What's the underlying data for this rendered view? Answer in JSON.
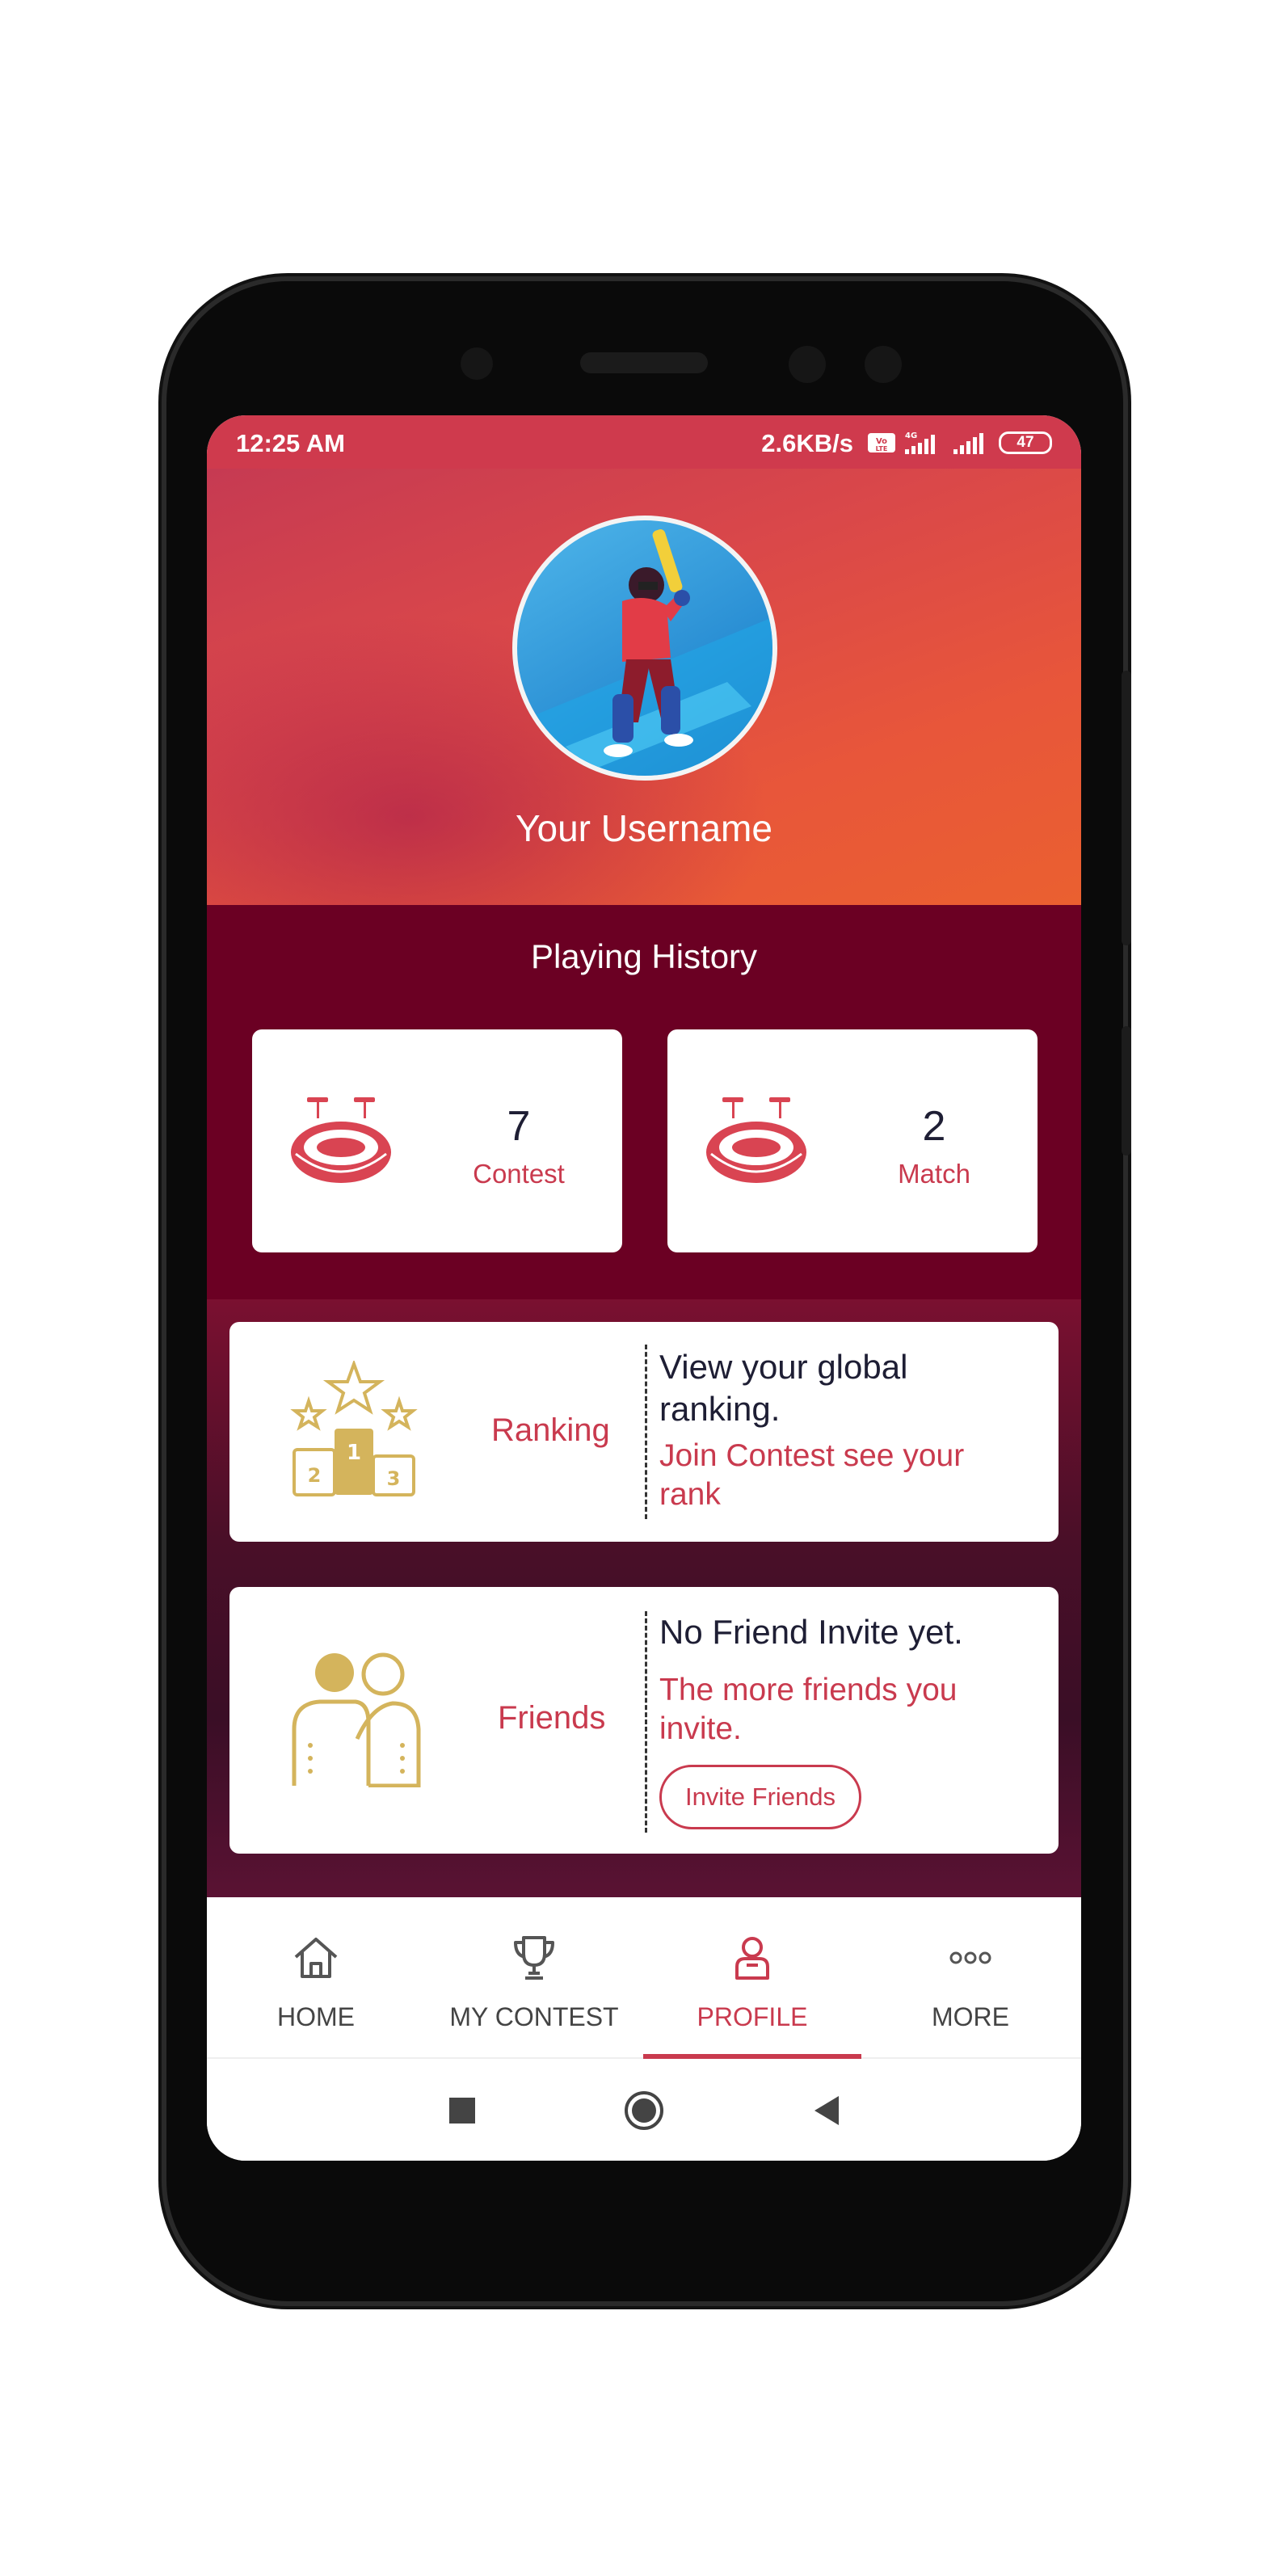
{
  "status_bar": {
    "time": "12:25 AM",
    "net_speed": "2.6KB/s",
    "battery": "47"
  },
  "profile": {
    "username": "Your Username",
    "avatar_icon": "cricket-batsman-avatar"
  },
  "playing_history": {
    "title": "Playing History",
    "stats": [
      {
        "value": "7",
        "label": "Contest",
        "icon": "stadium-icon"
      },
      {
        "value": "2",
        "label": "Match",
        "icon": "stadium-icon"
      }
    ]
  },
  "ranking": {
    "label": "Ranking",
    "text": "View your global ranking.",
    "subtext": "Join Contest see your rank",
    "icon": "podium-icon"
  },
  "friends": {
    "label": "Friends",
    "text": "No Friend Invite yet.",
    "subtext": "The more friends you invite.",
    "button": "Invite Friends",
    "icon": "friends-icon"
  },
  "bottom_nav": {
    "items": [
      {
        "label": "HOME",
        "icon": "home-icon"
      },
      {
        "label": "MY CONTEST",
        "icon": "trophy-icon"
      },
      {
        "label": "PROFILE",
        "icon": "user-icon"
      },
      {
        "label": "MORE",
        "icon": "more-dots-icon"
      }
    ],
    "active": "PROFILE"
  },
  "colors": {
    "accent": "#c93a4e",
    "history_bg": "#6b0023",
    "gold": "#d4b45c"
  }
}
